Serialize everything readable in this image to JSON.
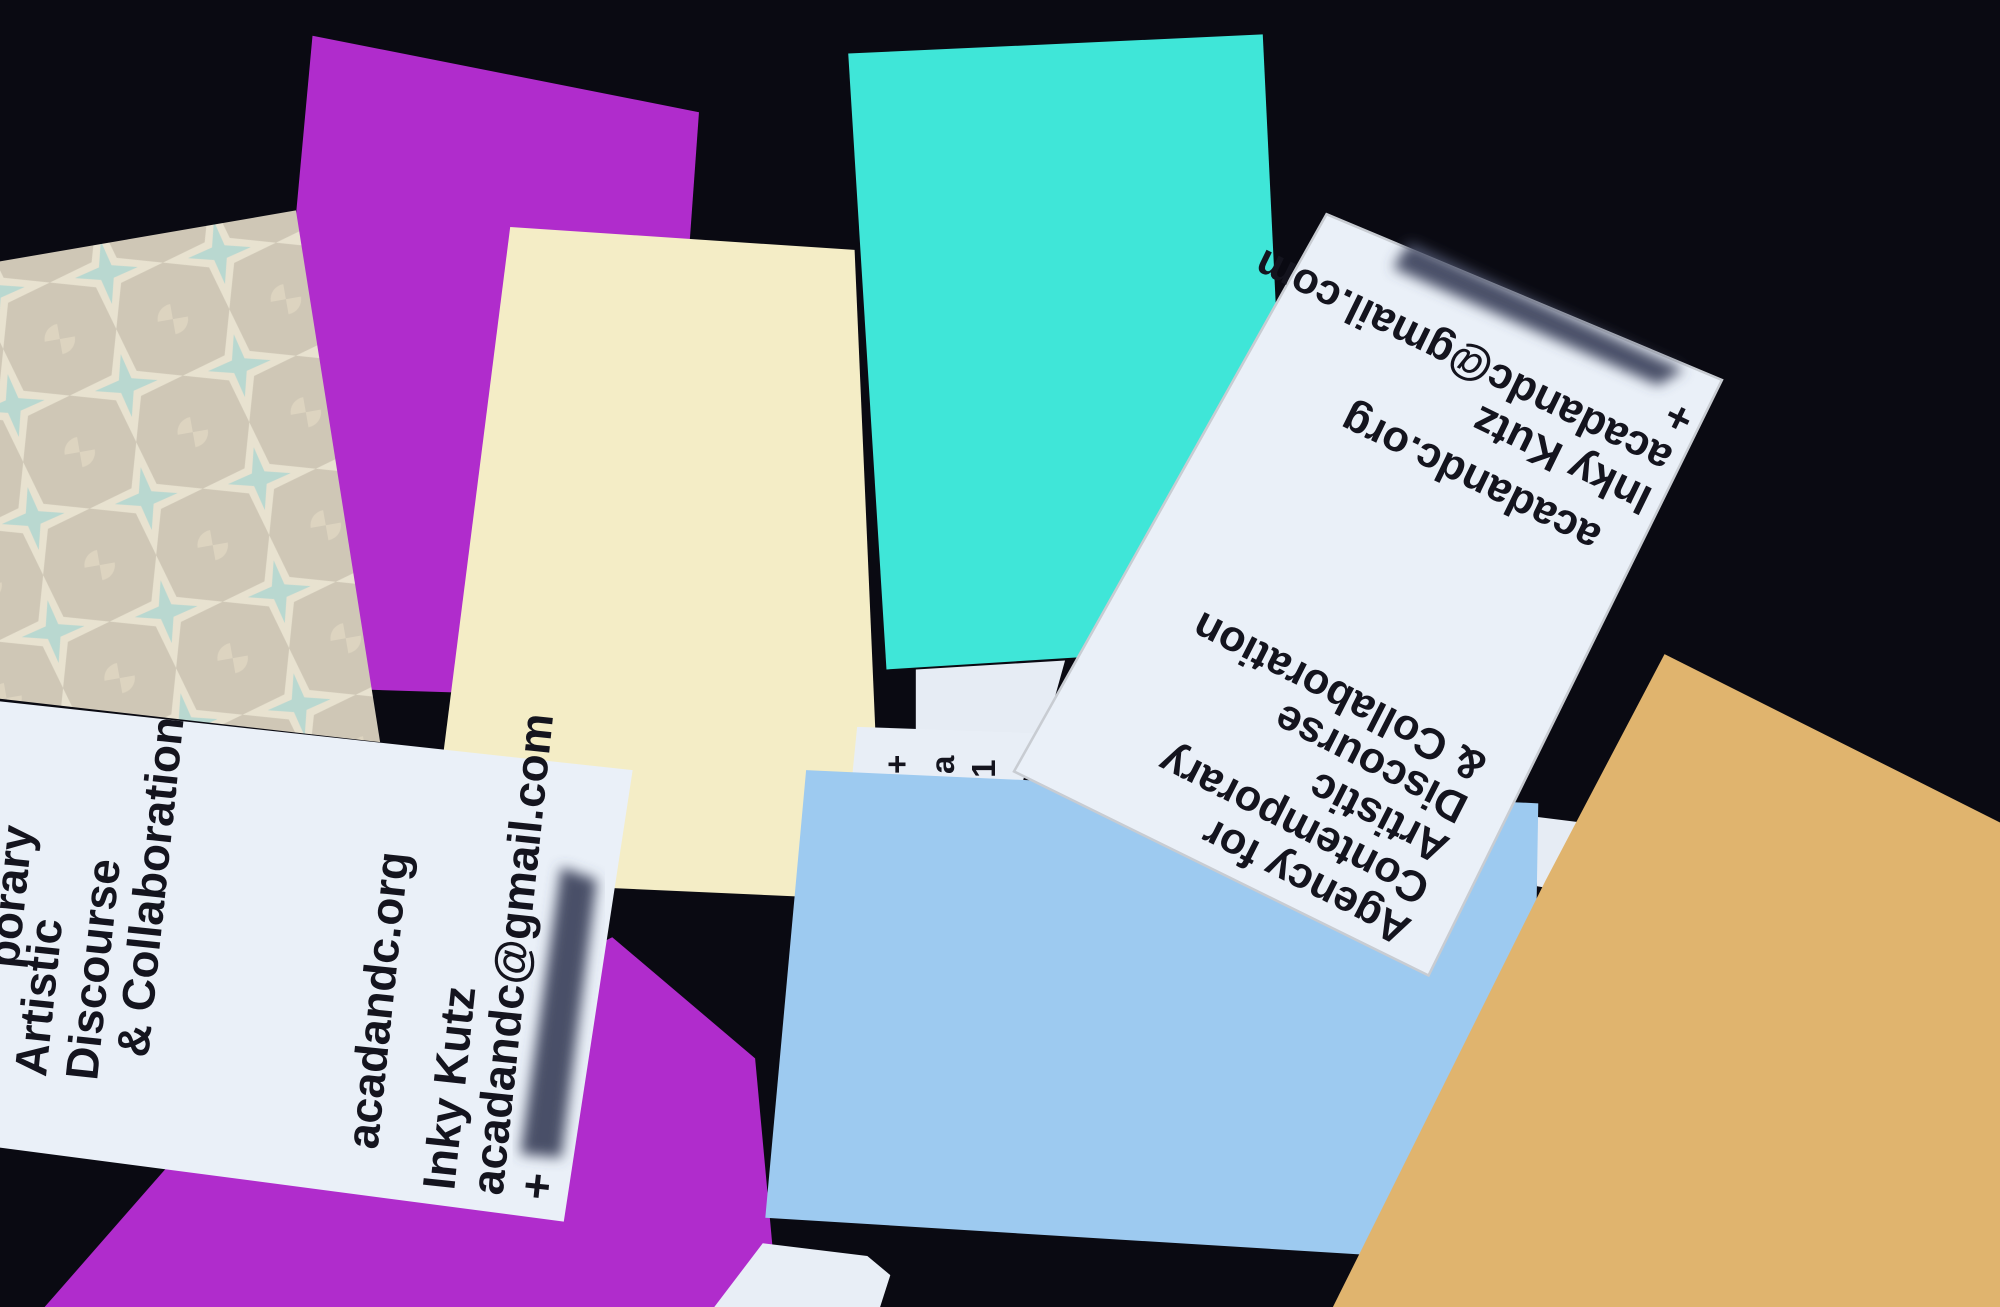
{
  "colors": {
    "background": "#0a0a12",
    "magenta": "#b02ccc",
    "holographic": "#cfc7b6",
    "cream": "#f4edc6",
    "cyan": "#3fe6d8",
    "light_blue": "#9dcaf0",
    "tan": "#e0b46e",
    "white_card": "#eaf0f8",
    "ink": "#14141e"
  },
  "left_card": {
    "lines": [
      "porary",
      "Artistic",
      "Discourse",
      "& Collaboration"
    ],
    "website": "acadandc.org",
    "name": "Inky Kutz",
    "email": "acadandc@gmail.com",
    "phone_prefix": "+"
  },
  "right_card": {
    "lines": [
      "Agency for",
      "Contemporary",
      "Artistic",
      "Discourse",
      "& Collaboration"
    ],
    "website": "acadandc.org",
    "name": "Inky Kutz",
    "email": "acadandc@gmail.com",
    "phone_prefix": "+"
  },
  "partial_card": {
    "glyphs": [
      "+",
      "a",
      "1"
    ]
  }
}
